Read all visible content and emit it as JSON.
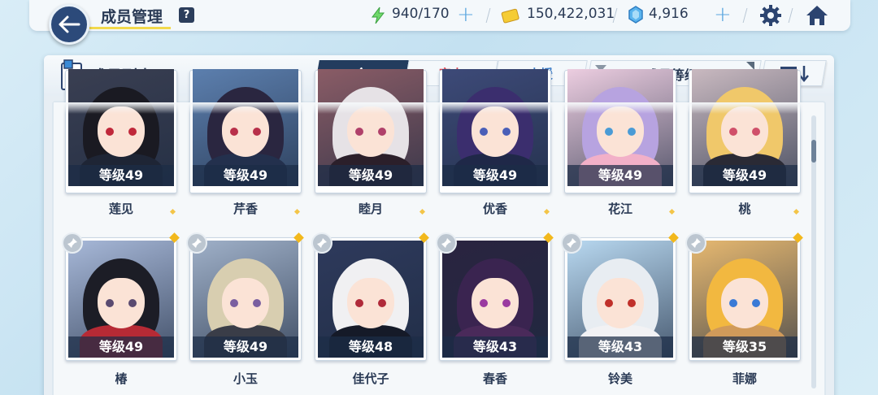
{
  "header": {
    "title": "成员管理",
    "help": "?",
    "ap": "940/170",
    "credits": "150,422,031",
    "gems": "4,916"
  },
  "panel": {
    "title": "成员列表",
    "tabs": [
      "全",
      "突击",
      "支援"
    ],
    "sort_label": "成员等级"
  },
  "members": [
    {
      "name": "莲见",
      "level": "等级49",
      "bg": "#3a3f52",
      "hair": "#1a1a22",
      "eye": "#c0283a",
      "outfit": "#1e2535"
    },
    {
      "name": "芹香",
      "level": "等级49",
      "bg": "#5c7fae",
      "hair": "#2a2640",
      "eye": "#b8304a",
      "outfit": "#23304d"
    },
    {
      "name": "睦月",
      "level": "等级49",
      "bg": "#8a5c66",
      "hair": "#e6e2e6",
      "eye": "#b0406a",
      "outfit": "#2b1f2a"
    },
    {
      "name": "优香",
      "level": "等级49",
      "bg": "#3d4a78",
      "hair": "#3b2e6e",
      "eye": "#4a5fb8",
      "outfit": "#1f2848"
    },
    {
      "name": "花江",
      "level": "等级49",
      "bg": "#eccde0",
      "hair": "#b7a3e0",
      "eye": "#4a9bd6",
      "outfit": "#f2b0c8"
    },
    {
      "name": "桃",
      "level": "等级49",
      "bg": "#c9b9c0",
      "hair": "#f0c86a",
      "eye": "#d0506a",
      "outfit": "#2a2a35"
    },
    {
      "name": "椿",
      "level": "等级49",
      "bg": "#a7b8d8",
      "hair": "#1c1d26",
      "eye": "#5a4a70",
      "outfit": "#b72a35"
    },
    {
      "name": "小玉",
      "level": "等级49",
      "bg": "#9fb0c8",
      "hair": "#d8ceb0",
      "eye": "#7a5fa0",
      "outfit": "#3a3d48"
    },
    {
      "name": "佳代子",
      "level": "等级48",
      "bg": "#2e3a5c",
      "hair": "#f0f0f2",
      "eye": "#b02a3a",
      "outfit": "#151a28"
    },
    {
      "name": "春香",
      "level": "等级43",
      "bg": "#2a2440",
      "hair": "#3a2450",
      "eye": "#9a3aa0",
      "outfit": "#4a2a5a"
    },
    {
      "name": "铃美",
      "level": "等级43",
      "bg": "#b8d8f0",
      "hair": "#e8edf2",
      "eye": "#c0302a",
      "outfit": "#f2f2f4"
    },
    {
      "name": "菲娜",
      "level": "等级35",
      "bg": "#e6b870",
      "hair": "#f2b840",
      "eye": "#3a7ad6",
      "outfit": "#d09a5a"
    }
  ],
  "icons": {
    "back": "back-arrow-icon",
    "ap": "bolt-icon",
    "credit": "credit-icon",
    "gem": "gem-icon",
    "settings": "gear-icon",
    "home": "home-icon",
    "pin": "pin-icon"
  }
}
